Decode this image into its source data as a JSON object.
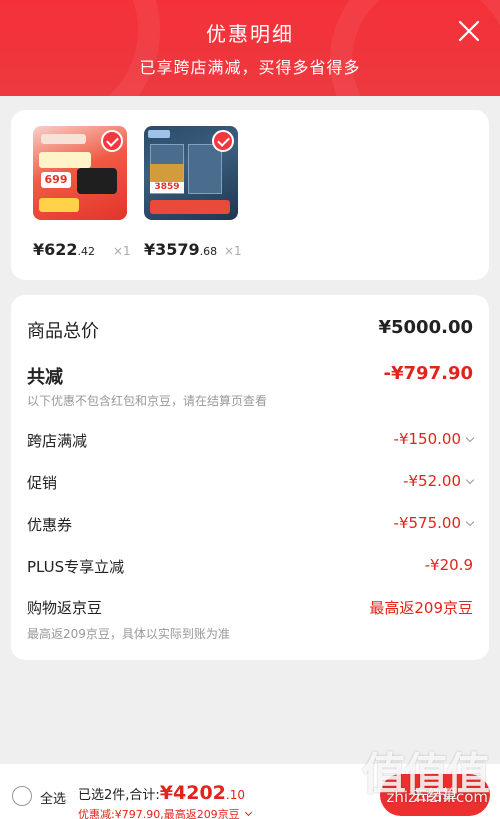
{
  "header": {
    "title": "优惠明细",
    "subtitle": "已享跨店满减，买得多省得多"
  },
  "products": [
    {
      "price_int": "¥622",
      "price_dec": ".42",
      "qty": "×1",
      "badge": "699"
    },
    {
      "price_int": "¥3579",
      "price_dec": ".68",
      "qty": "×1",
      "badge": "3859"
    }
  ],
  "summary": {
    "total_label": "商品总价",
    "total_value": "¥5000.00",
    "reduce_label": "共减",
    "reduce_value": "-¥797.90",
    "note": "以下优惠不包含红包和京豆，请在结算页查看",
    "items": [
      {
        "label": "跨店满减",
        "value": "-¥150.00"
      },
      {
        "label": "促销",
        "value": "-¥52.00"
      },
      {
        "label": "优惠券",
        "value": "-¥575.00"
      },
      {
        "label": "PLUS专享立减",
        "value": "-¥20.9"
      }
    ],
    "beans_label": "购物返京豆",
    "beans_value": "最高返209京豆",
    "beans_note": "最高返209京豆，具体以实际到账为准"
  },
  "bottom": {
    "select_all": "全选",
    "selected_text": "已选2件,合计:",
    "total_int": "¥4202",
    "total_dec": ".10",
    "discount_text": "优惠减:¥797.90,最高返209京豆",
    "checkout": "去结算"
  },
  "watermark": {
    "logo": "值值值",
    "url": "zhizhizhi.com"
  }
}
